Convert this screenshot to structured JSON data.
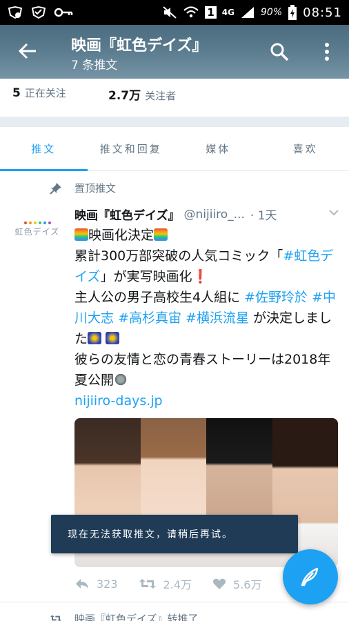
{
  "status_bar": {
    "network": "4G",
    "sim": "1",
    "battery": "90%",
    "time": "08:51"
  },
  "header": {
    "title": "映画『虹色デイズ』",
    "subtitle": "7 条推文"
  },
  "stats": {
    "following_count": "5",
    "following_label": "正在关注",
    "followers_count": "2.7万",
    "followers_label": "关注者"
  },
  "tabs": [
    {
      "label": "推文",
      "active": true
    },
    {
      "label": "推文和回复",
      "active": false
    },
    {
      "label": "媒体",
      "active": false
    },
    {
      "label": "喜欢",
      "active": false
    }
  ],
  "tweet": {
    "pinned_label": "置顶推文",
    "avatar_text": "虹色デイズ",
    "display_name": "映画『虹色デイズ』",
    "handle": "@nijiiro_...",
    "time": "· 1天",
    "lines": {
      "l1": "映画化決定",
      "l2a": "累計300万部突破の人気コミック「",
      "l2b": "#虹色デイズ",
      "l2c": "」が実写映画化❗",
      "l3a": "主人公の男子高校生4人組に",
      "h1": "#佐野玲於",
      "h2": "#中川大志",
      "h3": "#高杉真宙",
      "h4": "#横浜流星",
      "l3b": "が決定しました",
      "l4": "彼らの友情と恋の青春ストーリーは2018年夏公開",
      "link": "nijiiro-days.jp"
    },
    "replies": "323",
    "retweets": "2.4万",
    "likes": "5.6万"
  },
  "toast": "现在无法获取推文，请稍后再试。",
  "next_row": "映画『虹色デイズ』转推了",
  "colors": {
    "accent": "#1da1f2",
    "toast_bg": "#1f3b56"
  }
}
